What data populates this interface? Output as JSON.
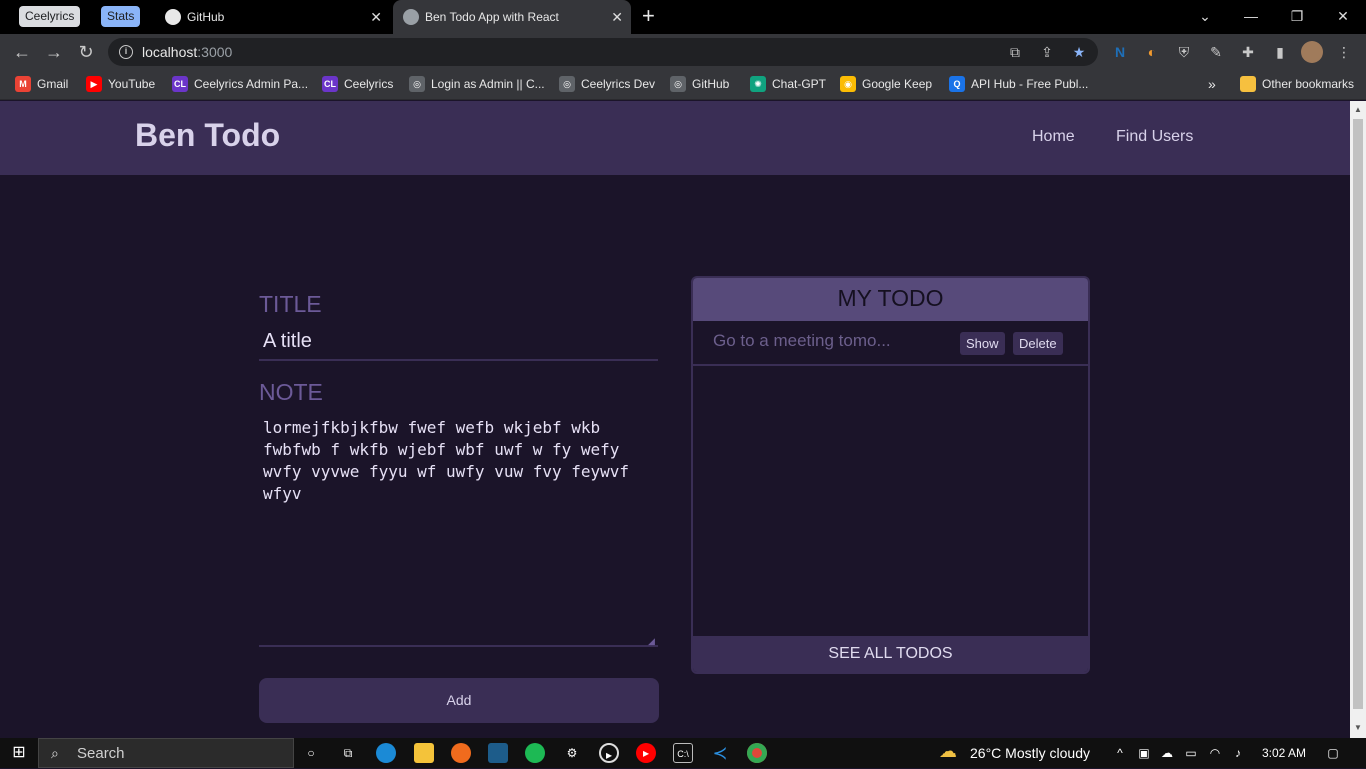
{
  "browser": {
    "tab_groups": [
      {
        "label": "Ceelyrics",
        "color": "#dadce0",
        "text_color": "#202124"
      },
      {
        "label": "Stats",
        "color": "#8ab4f8",
        "text_color": "#202124"
      }
    ],
    "tabs": [
      {
        "title": "GitHub",
        "active": false
      },
      {
        "title": "Ben Todo App with React",
        "active": true
      }
    ],
    "new_tab_label": "+",
    "address": {
      "host": "localhost",
      "port": ":3000"
    },
    "bookmarks": [
      {
        "label": "Gmail",
        "icon": "gmail-icon",
        "color": "#ea4335",
        "glyph": "M"
      },
      {
        "label": "YouTube",
        "icon": "youtube-icon",
        "color": "#ff0000",
        "glyph": "▶"
      },
      {
        "label": "Ceelyrics Admin Pa...",
        "icon": "ceelyrics-icon",
        "color": "#6b35c9",
        "glyph": "CL"
      },
      {
        "label": "Ceelyrics",
        "icon": "ceelyrics-icon",
        "color": "#6b35c9",
        "glyph": "CL"
      },
      {
        "label": "Login as Admin || C...",
        "icon": "globe-icon",
        "color": "#5f6368",
        "glyph": "◎"
      },
      {
        "label": "Ceelyrics Dev",
        "icon": "globe-icon",
        "color": "#5f6368",
        "glyph": "◎"
      },
      {
        "label": "GitHub",
        "icon": "github-icon",
        "color": "#5f6368",
        "glyph": "◎"
      },
      {
        "label": "Chat-GPT",
        "icon": "chatgpt-icon",
        "color": "#10a37f",
        "glyph": "✺"
      },
      {
        "label": "Google Keep",
        "icon": "keep-icon",
        "color": "#fbbc04",
        "glyph": "◉"
      },
      {
        "label": "API Hub - Free Publ...",
        "icon": "api-hub-icon",
        "color": "#1a73e8",
        "glyph": "Q"
      }
    ],
    "more_bookmarks": "»",
    "other_bookmarks": "Other bookmarks"
  },
  "app": {
    "brand": "Ben Todo",
    "nav": [
      {
        "label": "Home"
      },
      {
        "label": "Find Users"
      }
    ],
    "form": {
      "title_label": "TITLE",
      "title_value": "A title",
      "note_label": "NOTE",
      "note_value": "lormejfkbjkfbw fwef wefb wkjebf wkb fwbfwb f wkfb wjebf wbf uwf w fy wefy wvfy vyvwe fyyu wf uwfy vuw fvy feywvf wfyv",
      "add_label": "Add"
    },
    "todo_panel": {
      "heading": "MY TODO",
      "items": [
        {
          "text": "Go to a meeting tomo...",
          "show_label": "Show",
          "delete_label": "Delete"
        }
      ],
      "footer": "SEE ALL TODOS"
    }
  },
  "taskbar": {
    "search_label": "Search",
    "weather": "26°C  Mostly cloudy",
    "time": "3:02 AM"
  }
}
